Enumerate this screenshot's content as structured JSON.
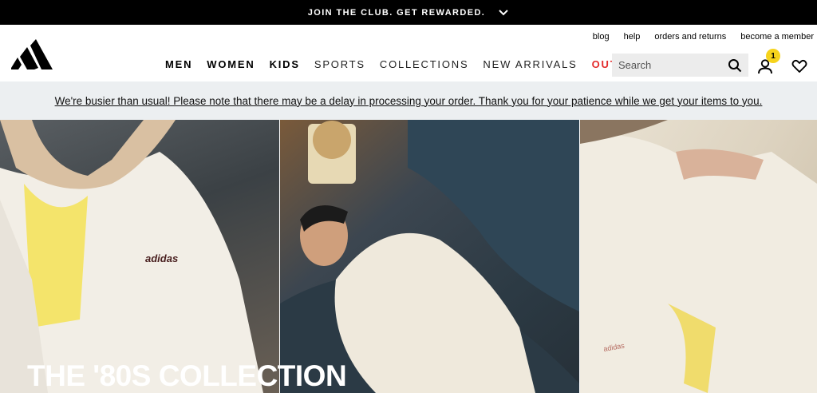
{
  "promo": {
    "text": "JOIN THE CLUB. GET REWARDED."
  },
  "header": {
    "utility_links": [
      "blog",
      "help",
      "orders and returns",
      "become a member"
    ],
    "nav": [
      {
        "label": "MEN",
        "style": "bold"
      },
      {
        "label": "WOMEN",
        "style": "bold"
      },
      {
        "label": "KIDS",
        "style": "bold"
      },
      {
        "label": "SPORTS",
        "style": "light"
      },
      {
        "label": "COLLECTIONS",
        "style": "light"
      },
      {
        "label": "NEW ARRIVALS",
        "style": "light"
      },
      {
        "label": "OUTLET",
        "style": "outlet"
      }
    ],
    "search": {
      "placeholder": "Search",
      "value": ""
    },
    "account_badge": "1",
    "colors": {
      "outlet": "#e32b2b",
      "badge": "#f6d31c"
    }
  },
  "notice": {
    "text": "We're busier than usual! Please note that there may be a delay in processing your order. Thank you for your patience while we get your items to you."
  },
  "hero": {
    "title": "THE '80S COLLECTION"
  }
}
